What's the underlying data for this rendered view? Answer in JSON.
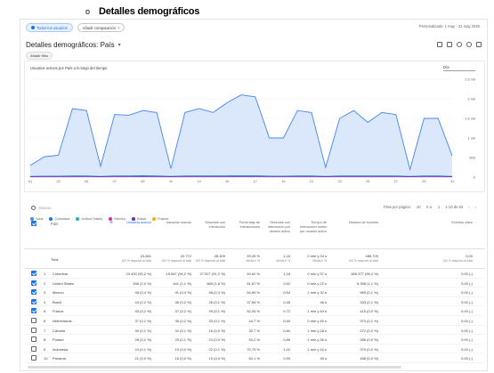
{
  "slide": {
    "bullet": "o",
    "title": "Detalles demográficos"
  },
  "topbar": {
    "chip_all_users": "Todos los usuarios",
    "chip_compare": "Añadir comparación",
    "date_range": "Personalizado: 1 may - 31 may 2020"
  },
  "report": {
    "title": "Detalles demográficos: País",
    "filter": "Añadir filtro"
  },
  "chart": {
    "title": "Usuarios activos por País a lo largo del tiempo",
    "granularity": "Día",
    "legend": [
      "Total",
      "Colombia",
      "United States",
      "Mexico",
      "Brazil",
      "France"
    ],
    "colors": {
      "total": "#4285f4",
      "total_fill": "#dbe7fb",
      "colombia": "#1a73e8",
      "us": "#12b5cb",
      "mexico": "#e52592",
      "brazil": "#7627bb",
      "france": "#f9ab00"
    }
  },
  "chart_data": {
    "type": "area",
    "x": [
      "01",
      "03",
      "05",
      "07",
      "09",
      "11",
      "13",
      "15",
      "17",
      "19",
      "21",
      "23",
      "25",
      "27",
      "29",
      "31"
    ],
    "ylim": [
      0,
      2500
    ],
    "yticks": [
      "0",
      "500",
      "1 mil",
      "1,5 mil",
      "2 mil",
      "2,5 mil"
    ],
    "series": [
      {
        "name": "Total",
        "values": [
          300,
          520,
          560,
          1750,
          1700,
          280,
          1600,
          1580,
          1700,
          1650,
          220,
          1650,
          1750,
          1650,
          1900,
          2100,
          2050,
          1000,
          1000,
          1700,
          1650,
          250,
          1500,
          1700,
          1400,
          1650,
          1600,
          200,
          1500,
          1500,
          550
        ]
      },
      {
        "name": "Colombia",
        "values": [
          20,
          25,
          25,
          30,
          30,
          20,
          30,
          30,
          35,
          30,
          20,
          30,
          30,
          30,
          35,
          35,
          35,
          25,
          25,
          30,
          30,
          20,
          30,
          30,
          30,
          30,
          30,
          20,
          30,
          30,
          20
        ]
      },
      {
        "name": "United States",
        "values": [
          10,
          12,
          12,
          15,
          15,
          10,
          15,
          15,
          15,
          15,
          10,
          15,
          15,
          15,
          15,
          15,
          15,
          12,
          12,
          15,
          15,
          10,
          15,
          15,
          15,
          15,
          15,
          10,
          15,
          15,
          10
        ]
      }
    ]
  },
  "table_toolbar": {
    "search_placeholder": "Buscar...",
    "rows_label": "Filas por página:",
    "rows_value": "10",
    "goto": "Ir a:",
    "page": "1",
    "range": "1-10 de 93"
  },
  "table": {
    "dimension": "País",
    "headers": [
      "Usuarios activos",
      "Usuarios nuevos",
      "Sesiones con interacción",
      "Porcentaje de interacciones",
      "Sesiones con interacción por usuario activo",
      "Tiempo de interacción medio por usuario activo",
      "Número de eventos",
      "Eventos clave"
    ],
    "total": {
      "label": "Total",
      "values": [
        "24.851",
        "20.772",
        "28.409",
        "49,26 %",
        "1,16",
        "0 min y 34 s",
        "486.709",
        "0,00"
      ],
      "sub": [
        "100 % respecto al total",
        "100 % respecto al total",
        "100 % respecto al total",
        "Media 0 %",
        "Media 0 %",
        "Media 0 %",
        "100 % respecto al total",
        "100 % respecto al total"
      ]
    },
    "rows": [
      {
        "n": "1",
        "country": "Colombia",
        "checked": true,
        "values": [
          "23.400 (93,2 %)",
          "19.567 (94,2 %)",
          "27.927 (91,2 %)",
          "49,62 %",
          "1,18",
          "0 min y 37 s",
          "469.377 (96,4 %)",
          "0,00 (-)"
        ]
      },
      {
        "n": "2",
        "country": "United States",
        "checked": true,
        "values": [
          "496 (2,0 %)",
          "441 (2,1 %)",
          "665 (1,8 %)",
          "61,67 %",
          "0,62",
          "0 min y 22 s",
          "5.398 (1,1 %)",
          "0,00 (-)"
        ]
      },
      {
        "n": "3",
        "country": "Mexico",
        "checked": true,
        "values": [
          "98 (0,4 %)",
          "91 (0,4 %)",
          "98 (0,3 %)",
          "54,69 %",
          "0,64",
          "1 min y 32 s",
          "965 (0,1 %)",
          "0,00 (-)"
        ]
      },
      {
        "n": "4",
        "country": "Brazil",
        "checked": true,
        "values": [
          "44 (0,2 %)",
          "36 (0,2 %)",
          "28 (0,1 %)",
          "37,84 %",
          "0,45",
          "46 s",
          "333 (0,1 %)",
          "0,00 (-)"
        ]
      },
      {
        "n": "5",
        "country": "France",
        "checked": true,
        "values": [
          "40 (0,2 %)",
          "37 (0,2 %)",
          "39 (0,1 %)",
          "52,94 %",
          "0,72",
          "1 min y 40 s",
          "415 (0,0 %)",
          "0,00 (-)"
        ]
      },
      {
        "n": "6",
        "country": "Netherlands",
        "checked": false,
        "values": [
          "37 (0,1 %)",
          "35 (0,2 %)",
          "33 (0,1 %)",
          "44,7 %",
          "0,60",
          "0 min y 45 s",
          "370 (0,1 %)",
          "0,00 (-)"
        ]
      },
      {
        "n": "7",
        "country": "Canada",
        "checked": false,
        "values": [
          "30 (0,1 %)",
          "32 (0,1 %)",
          "16 (0,0 %)",
          "32,7 %",
          "0,84",
          "1 min y 28 s",
          "272 (0,0 %)",
          "0,00 (-)"
        ]
      },
      {
        "n": "8",
        "country": "Poland",
        "checked": false,
        "values": [
          "28 (0,1 %)",
          "29 (0,1 %)",
          "24 (0,0 %)",
          "53,2 %",
          "0,86",
          "1 min y 36 s",
          "286 (0,0 %)",
          "0,00 (-)"
        ]
      },
      {
        "n": "9",
        "country": "Indonesia",
        "checked": false,
        "values": [
          "24 (0,1 %)",
          "19 (0,0 %)",
          "22 (0,1 %)",
          "70,75 %",
          "1,02",
          "1 min y 16 s",
          "379 (0,0 %)",
          "0,00 (-)"
        ]
      },
      {
        "n": "10",
        "country": "Panama",
        "checked": false,
        "values": [
          "21 (0,0 %)",
          "16 (0,0 %)",
          "19 (0,0 %)",
          "64,1 %",
          "0,90",
          "45 s",
          "168 (0,0 %)",
          "0,00 (-)"
        ]
      }
    ]
  }
}
